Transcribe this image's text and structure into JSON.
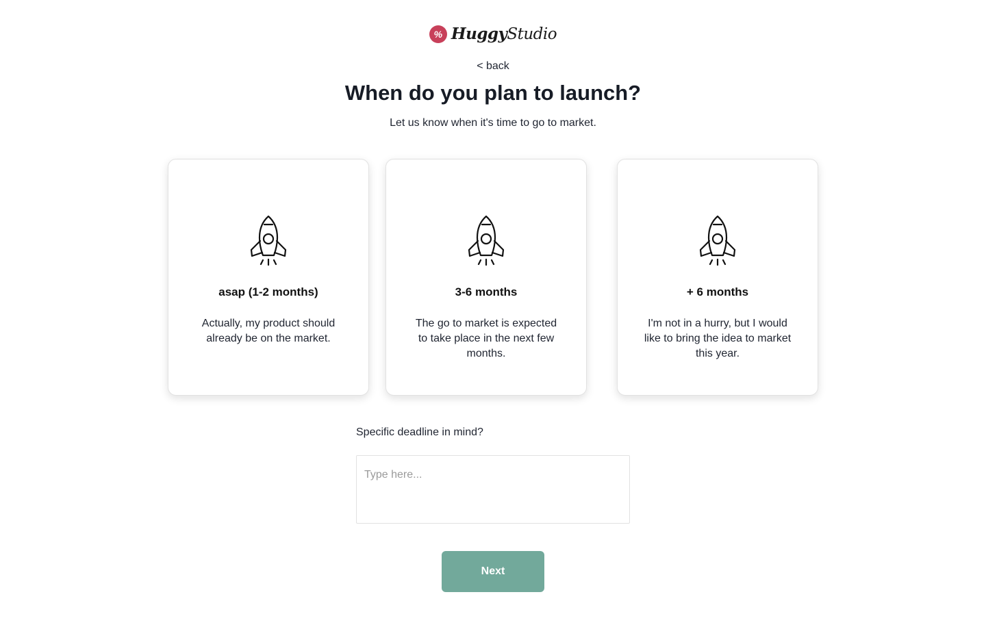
{
  "brand": {
    "logo_mark": "%",
    "name_bold": "Huggy",
    "name_regular": "Studio",
    "accent_color": "#c8405a"
  },
  "nav": {
    "back_label": "< back"
  },
  "header": {
    "title": "When do you plan to launch?",
    "subtitle": "Let us know when it's time to go to market."
  },
  "options": [
    {
      "icon": "rocket-icon",
      "title": "asap (1-2 months)",
      "description": "Actually, my product should already be on the market."
    },
    {
      "icon": "rocket-icon",
      "title": "3-6 months",
      "description": "The go to market is expected to take place in the next few months."
    },
    {
      "icon": "rocket-icon",
      "title": "+ 6 months",
      "description": "I'm not in a hurry, but I would like to bring the idea to market this year."
    }
  ],
  "deadline": {
    "label": "Specific deadline in mind?",
    "value": "",
    "placeholder": "Type here..."
  },
  "actions": {
    "next_label": "Next",
    "next_color": "#72a99b"
  }
}
